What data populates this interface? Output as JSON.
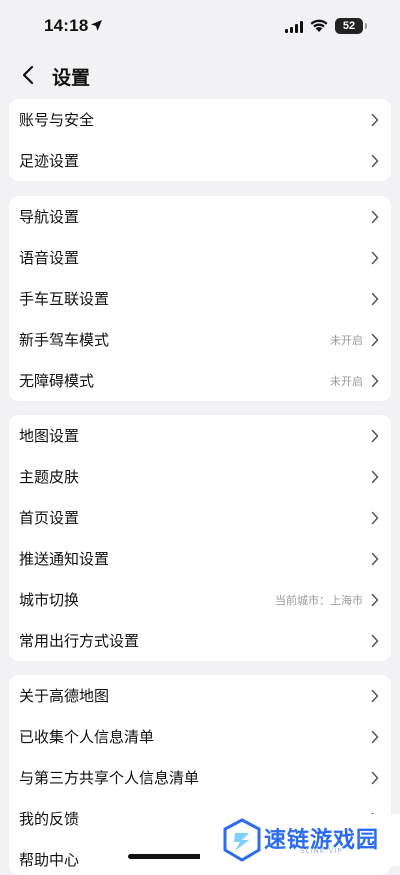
{
  "status": {
    "time": "14:18",
    "battery": "52"
  },
  "header": {
    "title": "设置"
  },
  "groups": [
    [
      {
        "label": "账号与安全"
      },
      {
        "label": "足迹设置"
      }
    ],
    [
      {
        "label": "导航设置"
      },
      {
        "label": "语音设置"
      },
      {
        "label": "手车互联设置"
      },
      {
        "label": "新手驾车模式",
        "value": "未开启"
      },
      {
        "label": "无障碍模式",
        "value": "未开启"
      }
    ],
    [
      {
        "label": "地图设置"
      },
      {
        "label": "主题皮肤"
      },
      {
        "label": "首页设置"
      },
      {
        "label": "推送通知设置"
      },
      {
        "label": "城市切换",
        "value": "当前城市：上海市"
      },
      {
        "label": "常用出行方式设置"
      }
    ],
    [
      {
        "label": "关于高德地图"
      },
      {
        "label": "已收集个人信息清单"
      },
      {
        "label": "与第三方共享个人信息清单"
      },
      {
        "label": "我的反馈"
      },
      {
        "label": "帮助中心"
      }
    ]
  ],
  "watermark": {
    "name": "速链游戏园",
    "sub": "SLINK.VIP"
  },
  "colors": {
    "background": "#f2f2f4",
    "card": "#ffffff",
    "accent": "#2c6cf0"
  }
}
